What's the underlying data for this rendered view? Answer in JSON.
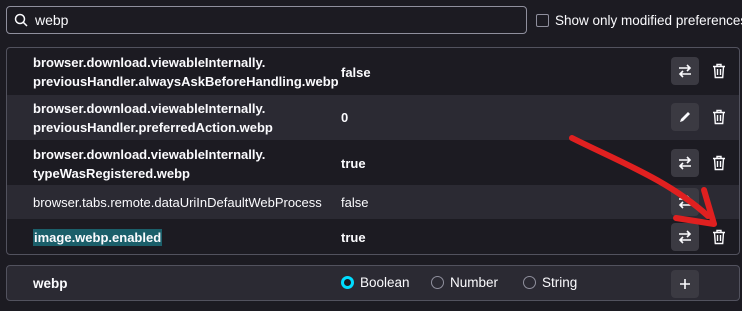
{
  "search": {
    "value": "webp",
    "modified_label": "Show only modified preferences"
  },
  "prefs": [
    {
      "name_line1": "browser.download.viewableInternally.",
      "name_line2": "previousHandler.alwaysAskBeforeHandling.webp",
      "value": "false",
      "action": "toggle-icon"
    },
    {
      "name_line1": "browser.download.viewableInternally.",
      "name_line2": "previousHandler.preferredAction.webp",
      "value": "0",
      "action": "pencil-icon"
    },
    {
      "name_line1": "browser.download.viewableInternally.",
      "name_line2": "typeWasRegistered.webp",
      "value": "true",
      "action": "toggle-icon"
    },
    {
      "name_line1": "browser.tabs.remote.dataUriInDefaultWebProcess",
      "value": "false",
      "action": "toggle-icon"
    },
    {
      "name_line1": "image.webp.enabled",
      "value": "true",
      "action": "toggle-icon"
    }
  ],
  "add_pref": {
    "name": "webp",
    "types": [
      "Boolean",
      "Number",
      "String"
    ],
    "selected": "Boolean"
  },
  "colors": {
    "accent": "#00ddff",
    "arrow": "#e02020",
    "highlight": "#1b5f6a"
  }
}
